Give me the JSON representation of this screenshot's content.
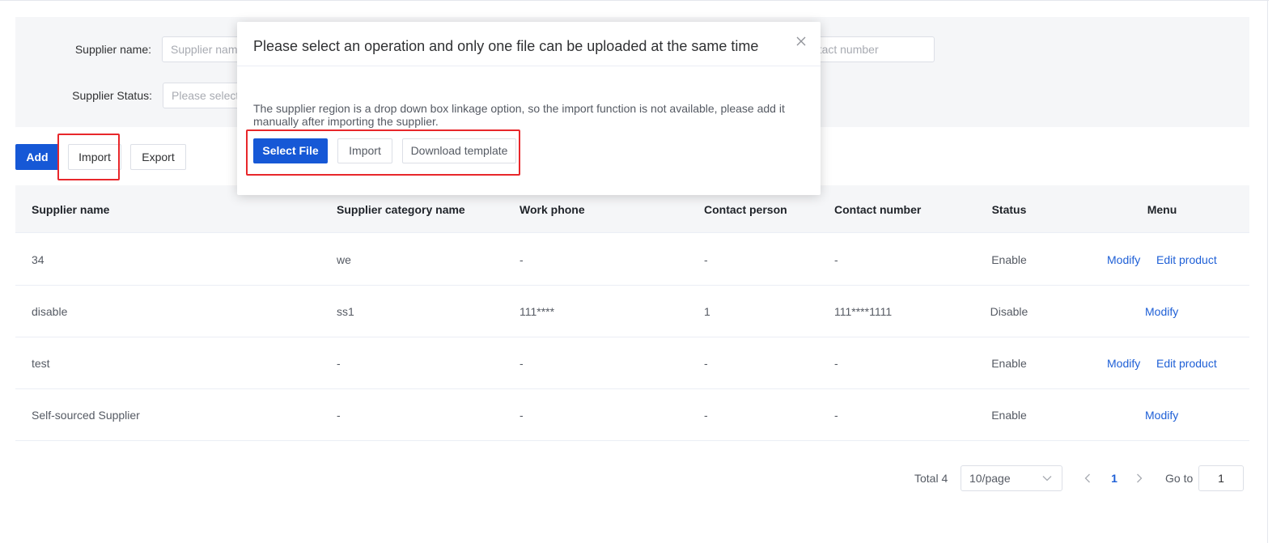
{
  "filters": {
    "supplier_name_label": "Supplier name:",
    "supplier_name_placeholder": "Supplier name",
    "supplier_status_label": "Supplier Status:",
    "supplier_status_placeholder": "Please select",
    "contact_number_placeholder": "Contact number"
  },
  "toolbar": {
    "add_label": "Add",
    "import_label": "Import",
    "export_label": "Export"
  },
  "table": {
    "columns": [
      "Supplier name",
      "Supplier category name",
      "Work phone",
      "Contact person",
      "Contact number",
      "Status",
      "Menu"
    ],
    "rows": [
      {
        "name": "34",
        "category": "we",
        "work_phone": "-",
        "contact_person": "-",
        "contact_number": "-",
        "status": "Enable",
        "actions": [
          "Modify",
          "Edit product"
        ]
      },
      {
        "name": "disable",
        "category": "ss1",
        "work_phone": "111****",
        "contact_person": "1",
        "contact_number": "111****1111",
        "status": "Disable",
        "actions": [
          "Modify"
        ]
      },
      {
        "name": "test",
        "category": "-",
        "work_phone": "-",
        "contact_person": "-",
        "contact_number": "-",
        "status": "Enable",
        "actions": [
          "Modify",
          "Edit product"
        ]
      },
      {
        "name": "Self-sourced Supplier",
        "category": "-",
        "work_phone": "-",
        "contact_person": "-",
        "contact_number": "-",
        "status": "Enable",
        "actions": [
          "Modify"
        ]
      }
    ]
  },
  "pagination": {
    "total_label": "Total 4",
    "page_size": "10/page",
    "current_page": "1",
    "goto_label": "Go to",
    "goto_value": "1"
  },
  "modal": {
    "title": "Please select an operation and only one file can be uploaded at the same time",
    "description": "The supplier region is a drop down box linkage option, so the import function is not available, please add it manually after importing the supplier.",
    "select_file_label": "Select File",
    "import_label": "Import",
    "download_template_label": "Download template"
  },
  "colors": {
    "primary": "#1658d6",
    "link": "#1e5fd6",
    "highlight_box": "#e8272b",
    "panel_bg": "#f5f6f8"
  }
}
